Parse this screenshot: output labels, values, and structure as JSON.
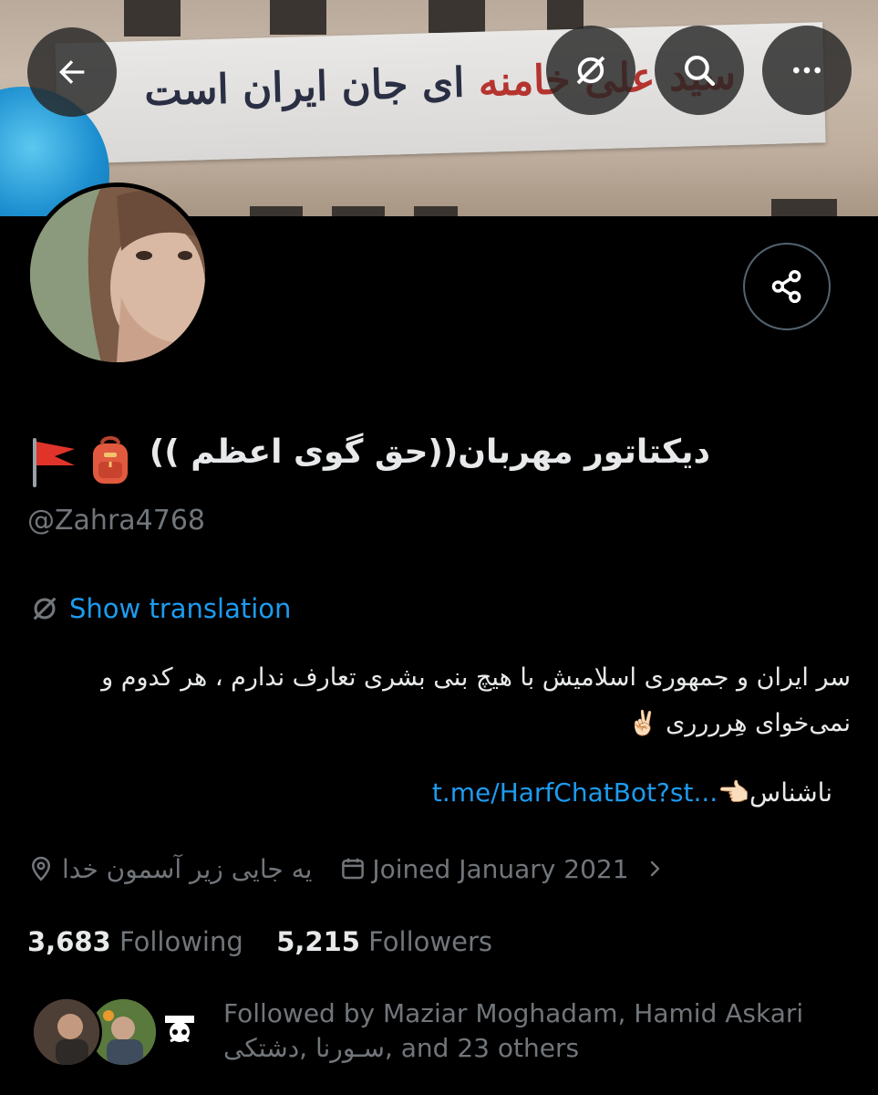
{
  "banner": {
    "slogan_black": "ای جان ایران است",
    "slogan_red": "سید علی خامنه"
  },
  "nav": {
    "back_icon": "arrow-left-icon",
    "translate_icon": "translate-icon",
    "search_icon": "search-icon",
    "more_icon": "more-icon"
  },
  "profile": {
    "display_name": "دیکتاتور مهربان((حق گوی اعظم ))",
    "name_emoji_1": "🎒",
    "name_emoji_2": "🚩",
    "handle": "@Zahra4768",
    "share_icon": "share-icon"
  },
  "translation": {
    "label": "Show translation",
    "icon": "translate-icon"
  },
  "bio": {
    "line1": "سر ایران و جمهوری اسلامیش با هیچ بنی بشری تعارف ندارم ، هر کدوم و",
    "line2": "نمی‌خوای هِرررری",
    "emoji": "✌🏻"
  },
  "link_line": {
    "prefix": "ناشناس",
    "emoji": "👈🏻",
    "link": "t.me/HarfChatBot?st..."
  },
  "meta": {
    "location": "یه جایی زیر آسمون خدا",
    "joined": "Joined January 2021",
    "location_icon": "location-pin-icon",
    "calendar_icon": "calendar-icon",
    "chevron_icon": "chevron-right-icon"
  },
  "stats": {
    "following_count": "3,683",
    "following_label": "Following",
    "followers_count": "5,215",
    "followers_label": "Followers"
  },
  "followed_by": {
    "line1": "Followed by Maziar Moghadam, Hamid Askari",
    "line2": "سـورنا ,دشتکی, and 23 others"
  },
  "colors": {
    "background": "#000000",
    "text": "#e7e9ea",
    "secondary": "#71767b",
    "accent": "#1d9bf0"
  }
}
